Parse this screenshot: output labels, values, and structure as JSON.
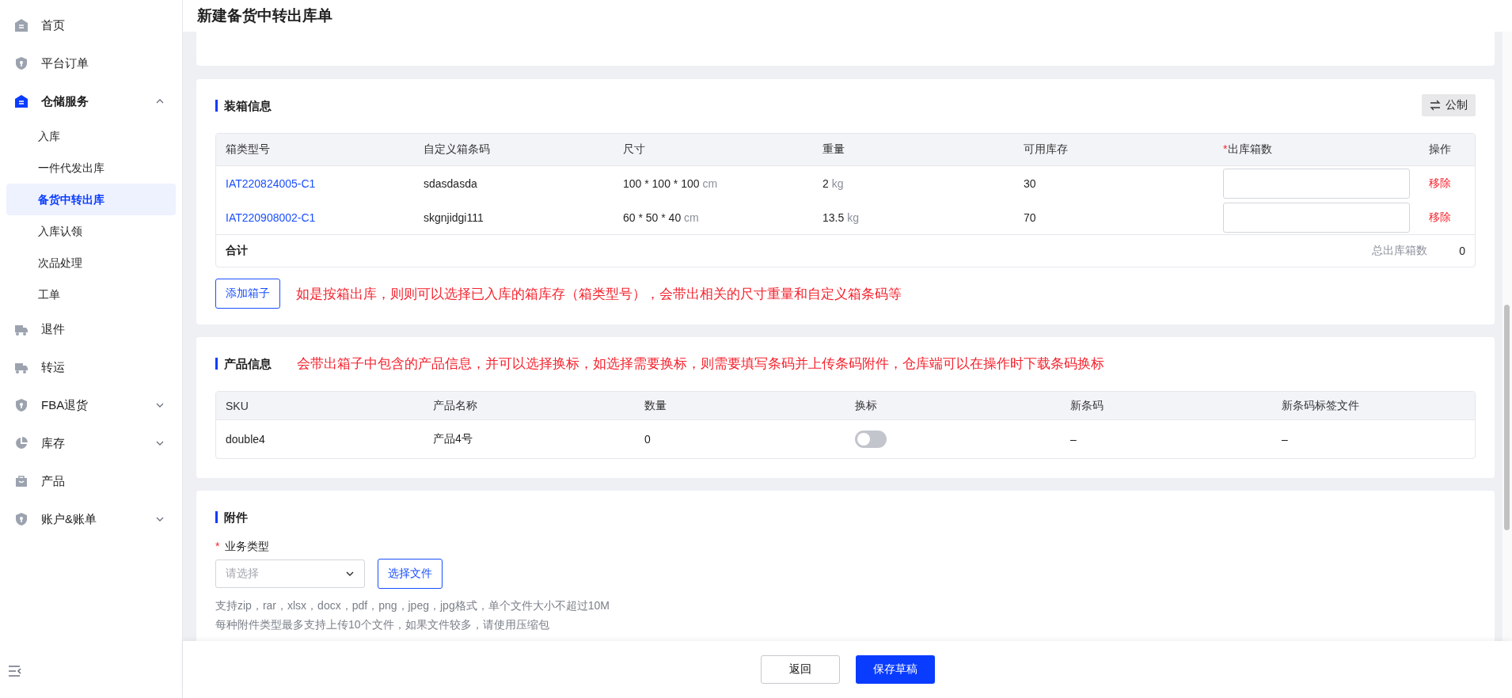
{
  "sidebar": {
    "items": [
      {
        "kind": "link",
        "label": "首页",
        "selected": false
      },
      {
        "kind": "link",
        "label": "平台订单",
        "selected": false
      },
      {
        "kind": "group",
        "label": "仓储服务",
        "selected": true,
        "expanded": true,
        "children": [
          {
            "label": "入库",
            "selected": false
          },
          {
            "label": "一件代发出库",
            "selected": false
          },
          {
            "label": "备货中转出库",
            "selected": true
          },
          {
            "label": "入库认领",
            "selected": false
          },
          {
            "label": "次品处理",
            "selected": false
          },
          {
            "label": "工单",
            "selected": false
          }
        ]
      },
      {
        "kind": "link",
        "label": "退件",
        "selected": false
      },
      {
        "kind": "link",
        "label": "转运",
        "selected": false
      },
      {
        "kind": "group",
        "label": "FBA退货",
        "selected": false,
        "expanded": false
      },
      {
        "kind": "group",
        "label": "库存",
        "selected": false,
        "expanded": false
      },
      {
        "kind": "link",
        "label": "产品",
        "selected": false
      },
      {
        "kind": "group",
        "label": "账户&账单",
        "selected": false,
        "expanded": false
      }
    ]
  },
  "page_title": "新建备货中转出库单",
  "packing": {
    "title": "装箱信息",
    "unit_button": "公制",
    "columns": [
      {
        "label": "箱类型号",
        "required": false
      },
      {
        "label": "自定义箱条码",
        "required": false
      },
      {
        "label": "尺寸",
        "required": false
      },
      {
        "label": "重量",
        "required": false
      },
      {
        "label": "可用库存",
        "required": false
      },
      {
        "label": "出库箱数",
        "required": true
      },
      {
        "label": "操作",
        "required": false
      }
    ],
    "required_mark": "*",
    "rows": [
      {
        "box_type": "IAT220824005-C1",
        "barcode": "sdasdasda",
        "size": "100 * 100 * 100",
        "size_unit": "cm",
        "weight": "2",
        "weight_unit": "kg",
        "stock": "30",
        "quantity": "",
        "action": "移除"
      },
      {
        "box_type": "IAT220908002-C1",
        "barcode": "skgnjidgi111",
        "size": "60 * 50 * 40",
        "size_unit": "cm",
        "weight": "13.5",
        "weight_unit": "kg",
        "stock": "70",
        "quantity": "",
        "action": "移除"
      }
    ],
    "total_label": "合计",
    "total_boxes_label": "总出库箱数",
    "total_boxes": "0",
    "add_button": "添加箱子",
    "note": "如是按箱出库，则则可以选择已入库的箱库存（箱类型号），会带出相关的尺寸重量和自定义箱条码等"
  },
  "products": {
    "title": "产品信息",
    "note": "会带出箱子中包含的产品信息，并可以选择换标，如选择需要换标，则需要填写条码并上传条码附件，仓库端可以在操作时下载条码换标",
    "columns": [
      "SKU",
      "产品名称",
      "数量",
      "换标",
      "新条码",
      "新条码标签文件"
    ],
    "rows": [
      {
        "sku": "double4",
        "name": "产品4号",
        "quantity": "0",
        "relabel_on": false,
        "new_barcode": "–",
        "label_file": "–"
      }
    ]
  },
  "attachments": {
    "title": "附件",
    "required_mark": "*",
    "field_label": "业务类型",
    "placeholder": "请选择",
    "file_button": "选择文件",
    "hints": [
      "支持zip，rar，xlsx，docx，pdf，png，jpeg，jpg格式，单个文件大小不超过10M",
      "每种附件类型最多支持上传10个文件，如果文件较多，请使用压缩包"
    ]
  },
  "footer": {
    "back_button": "返回",
    "save_button": "保存草稿"
  }
}
